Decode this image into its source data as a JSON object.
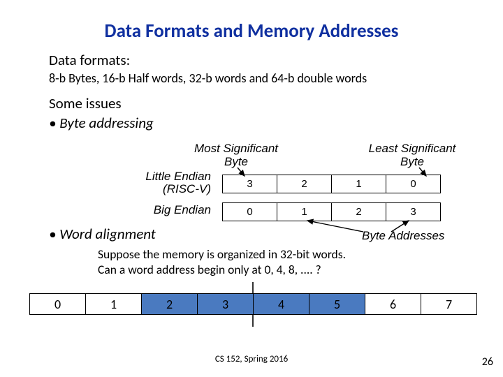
{
  "title": "Data Formats and Memory Addresses",
  "line1": "Data formats:",
  "line2": "8-b Bytes, 16-b Half words, 32-b words and 64-b double words",
  "some_issues": "Some issues",
  "bullet1": "• Byte addressing",
  "msb_l1": "Most Significant",
  "msb_l2": "Byte",
  "lsb_l1": "Least Significant",
  "lsb_l2": "Byte",
  "le_l1": "Little Endian",
  "le_l2": "(RISC-V)",
  "be": "Big Endian",
  "row_le": [
    "3",
    "2",
    "1",
    "0"
  ],
  "row_be": [
    "0",
    "1",
    "2",
    "3"
  ],
  "bullet2": "• Word alignment",
  "byte_addresses": "Byte Addresses",
  "suppose_l1": "Suppose the memory is organized in 32-bit words.",
  "suppose_l2": "Can a word address begin only at 0, 4, 8, .... ?",
  "mem": [
    "0",
    "1",
    "2",
    "3",
    "4",
    "5",
    "6",
    "7"
  ],
  "footer": "CS 152, Spring 2016",
  "pagenum": "26"
}
